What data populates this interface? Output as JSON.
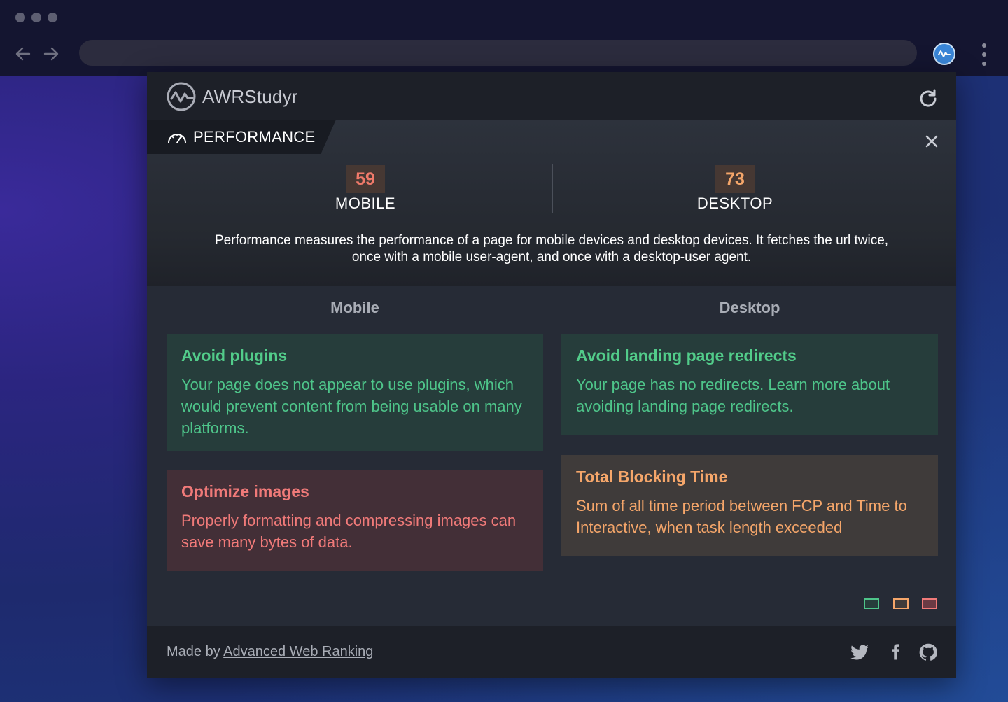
{
  "app": {
    "name": "AWRStudyr"
  },
  "section": {
    "title": "PERFORMANCE"
  },
  "scores": {
    "mobile": {
      "value": "59",
      "label": "MOBILE",
      "color": "#f07a6a"
    },
    "desktop": {
      "value": "73",
      "label": "DESKTOP",
      "color": "#f5a66a"
    }
  },
  "description_line1": "Performance measures the performance of a page for mobile devices and desktop devices. It fetches the url twice,",
  "description_line2": "once with a mobile user-agent, and once with a desktop-user agent.",
  "columns": {
    "mobile": {
      "heading": "Mobile",
      "cards": [
        {
          "title": "Avoid plugins",
          "body": "Your page does not appear to use plugins, which would prevent content from being usable on many platforms.",
          "status": "pass"
        },
        {
          "title": "Optimize images",
          "body": "Properly formatting and compressing images can save many bytes of data.",
          "status": "fail"
        }
      ]
    },
    "desktop": {
      "heading": "Desktop",
      "cards": [
        {
          "title": "Avoid landing page redirects",
          "body": "Your page has no redirects. Learn more about avoiding landing page redirects.",
          "status": "pass"
        },
        {
          "title": "Total Blocking Time",
          "body": "Sum of all time period between FCP and Time to Interactive, when task length exceeded",
          "status": "warn"
        }
      ]
    }
  },
  "legend": [
    {
      "status": "pass",
      "color": "#4ec58a"
    },
    {
      "status": "warn",
      "color": "#f5a66a"
    },
    {
      "status": "fail",
      "color": "#f07a79"
    }
  ],
  "footer": {
    "made_by": "Made by",
    "link_text": "Advanced Web Ranking"
  },
  "icons": [
    "back-arrow-icon",
    "forward-arrow-icon",
    "awr-extension-icon",
    "kebab-menu-icon",
    "awr-logo-icon",
    "refresh-icon",
    "speedometer-icon",
    "close-icon",
    "twitter-icon",
    "facebook-icon",
    "github-icon"
  ]
}
